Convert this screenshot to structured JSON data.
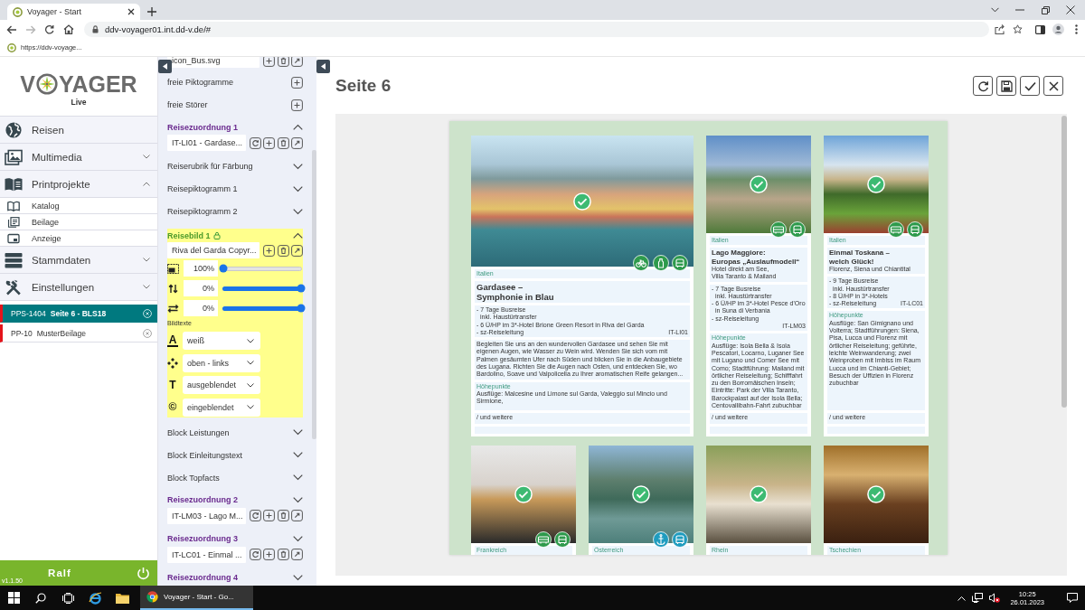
{
  "browser": {
    "tab_title": "Voyager - Start",
    "url": "ddv-voyager01.int.dd-v.de/#",
    "bookmark": "https://ddv-voyage..."
  },
  "sidebar": {
    "logo_parts": [
      "V",
      "YAGER"
    ],
    "edition": "Live",
    "nav": [
      {
        "label": "Reisen"
      },
      {
        "label": "Multimedia",
        "expanded": false
      },
      {
        "label": "Printprojekte",
        "expanded": true,
        "children": [
          {
            "label": "Katalog"
          },
          {
            "label": "Beilage"
          },
          {
            "label": "Anzeige"
          }
        ]
      },
      {
        "label": "Stammdaten",
        "expanded": false
      },
      {
        "label": "Einstellungen",
        "expanded": false
      }
    ],
    "open_projects": [
      {
        "code": "PPS-1404",
        "title": "Seite 6 - BLS18",
        "selected": true
      },
      {
        "code": "PP-10",
        "title": "MusterBeilage",
        "selected": false
      }
    ],
    "user": "Ralf",
    "version": "v1.1.50"
  },
  "editor": {
    "rows": [
      {
        "kind": "file",
        "value": "icon_Bus.svg"
      },
      {
        "kind": "add",
        "label": "freie Piktogramme"
      },
      {
        "kind": "add",
        "label": "freie Störer"
      },
      {
        "kind": "group",
        "label": "Reisezuordnung 1",
        "expanded": true
      },
      {
        "kind": "assignment",
        "value": "IT-LI01 - Gardase..."
      },
      {
        "kind": "block",
        "label": "Reiserubrik für Färbung",
        "expanded": false
      },
      {
        "kind": "block",
        "label": "Reisepiktogramm 1",
        "expanded": false
      },
      {
        "kind": "block",
        "label": "Reisepiktogramm 2",
        "expanded": false
      },
      {
        "kind": "image",
        "label": "Reisebild 1",
        "locked": true,
        "expanded": true,
        "file": "Riva del Garda Copyr...",
        "adjustments": [
          {
            "value": "100%",
            "level": 0
          },
          {
            "value": "0%",
            "level": 1
          },
          {
            "value": "0%",
            "level": 1
          }
        ],
        "captions_label": "Bildtexte",
        "caption_settings": [
          {
            "symbol": "A",
            "value": "weiß"
          },
          {
            "value": "oben - links"
          },
          {
            "symbol": "T",
            "value": "ausgeblendet"
          },
          {
            "symbol": "©",
            "value": "eingeblendet"
          }
        ]
      },
      {
        "kind": "block",
        "label": "Block Leistungen",
        "expanded": false
      },
      {
        "kind": "block",
        "label": "Block Einleitungstext",
        "expanded": false
      },
      {
        "kind": "block",
        "label": "Block Topfacts",
        "expanded": false
      },
      {
        "kind": "group",
        "label": "Reisezuordnung 2",
        "expanded": false
      },
      {
        "kind": "assignment",
        "value": "IT-LM03 - Lago M..."
      },
      {
        "kind": "group",
        "label": "Reisezuordnung 3",
        "expanded": false
      },
      {
        "kind": "assignment",
        "value": "IT-LC01 - Einmal ..."
      },
      {
        "kind": "group",
        "label": "Reisezuordnung 4",
        "expanded": false
      }
    ]
  },
  "page": {
    "title": "Seite 6",
    "cards": [
      {
        "kind": "wide",
        "checked": true,
        "color": "#2e9a4c",
        "pictograms": [
          {
            "kind": "bicycle"
          },
          {
            "kind": "bottle"
          },
          {
            "kind": "coach"
          }
        ],
        "country": "Italien",
        "title": "Gardasee –\nSymphonie in Blau",
        "services": [
          "- 7 Tage Busreise\ninkl. Haustürtransfer",
          "- 6 Ü/HP im 3*-Hotel Brione Green Resort in Riva del Garda",
          "- sz-Reiseleitung"
        ],
        "code": "IT-LI01",
        "intro": "Begleiten Sie uns an den wundervollen Gardasee und sehen Sie mit eigenen Augen, wie Wasser zu Wein wird. Wenden Sie sich vom mit Palmen gesäumten Ufer nach Süden und blicken Sie in die Anbaugebiete des Lugana. Richten Sie die Augen nach Osten, und entdecken Sie, wo Bardolino, Soave und Valpolicella zu Ihrer aromatischen Reife gelangen...",
        "highlights_label": "Höhepunkte",
        "highlights": "Ausflüge: Malcesine und Limone sul Garda, Valeggio sul Mincio und Sirmione,",
        "more": "/ und weitere"
      },
      {
        "kind": "standard",
        "checked": true,
        "color": "#2e9a4c",
        "pictograms": [
          {
            "kind": "bus"
          },
          {
            "kind": "coach"
          }
        ],
        "country": "Italien",
        "title": "Lago Maggiore:\nEuropas „Auslaufmodell“",
        "subtitle": "Hotel direkt am See,\nVilla Taranto & Mailand",
        "services": [
          "- 7 Tage Busreise\ninkl. Haustürtransfer",
          "- 6 Ü/HP im 3*-Hotel Pesce d'Oro in Suna di Verbania",
          "- sz-Reiseleitung"
        ],
        "code": "IT-LM03",
        "highlights_label": "Höhepunkte",
        "highlights": "Ausflüge: Isola Bella & Isola Pescatori, Locarno, Luganer See mit Lugano und Comer See mit Como; Stadtführung: Mailand mit örtlicher Reiseleitung; Schifffahrt zu den Borromäischen Inseln; Eintritte: Park der Villa Taranto, Barockpalast auf der Isola Bella; Centovallibahn-Fahrt zubuchbar",
        "more": "/ und weitere"
      },
      {
        "kind": "standard",
        "checked": true,
        "color": "#2e9a4c",
        "pictograms": [
          {
            "kind": "bus"
          },
          {
            "kind": "coach"
          }
        ],
        "country": "Italien",
        "title": "Einmal Toskana –\nwelch Glück!",
        "subtitle": "Florenz, Siena und Chiantital",
        "services": [
          "- 9 Tage Busreise\ninkl. Haustürtransfer",
          "- 8 Ü/HP in 3*-Hotels",
          "- sz-Reiseleitung"
        ],
        "code": "IT-LC01",
        "highlights_label": "Höhepunkte",
        "highlights": "Ausflüge: San Gimignano und Volterra; Stadtführungen: Siena, Pisa, Lucca und Florenz mit örtlicher Reiseleitung; geführte, leichte Weinwanderung; zwei Weinproben mit Imbiss im Raum Lucca und im Chianti-Gebiet; Besuch der Uffizien in Florenz zubuchbar",
        "more": "/ und weitere"
      },
      {
        "kind": "standard",
        "checked": true,
        "color": "#2e9a4c",
        "pictograms": [
          {
            "kind": "bus"
          },
          {
            "kind": "coach"
          }
        ],
        "country": "Frankreich"
      },
      {
        "kind": "standard",
        "checked": true,
        "color": "#1f9cbf",
        "pictograms": [
          {
            "kind": "anchor"
          },
          {
            "kind": "coach"
          }
        ],
        "country": "Österreich"
      },
      {
        "kind": "standard",
        "checked": true,
        "country": "Rhein"
      },
      {
        "kind": "standard",
        "checked": true,
        "country": "Tschechien"
      }
    ]
  },
  "taskbar": {
    "app_title": "Voyager - Start - Go...",
    "time": "10:25",
    "date": "26.01.2023"
  }
}
